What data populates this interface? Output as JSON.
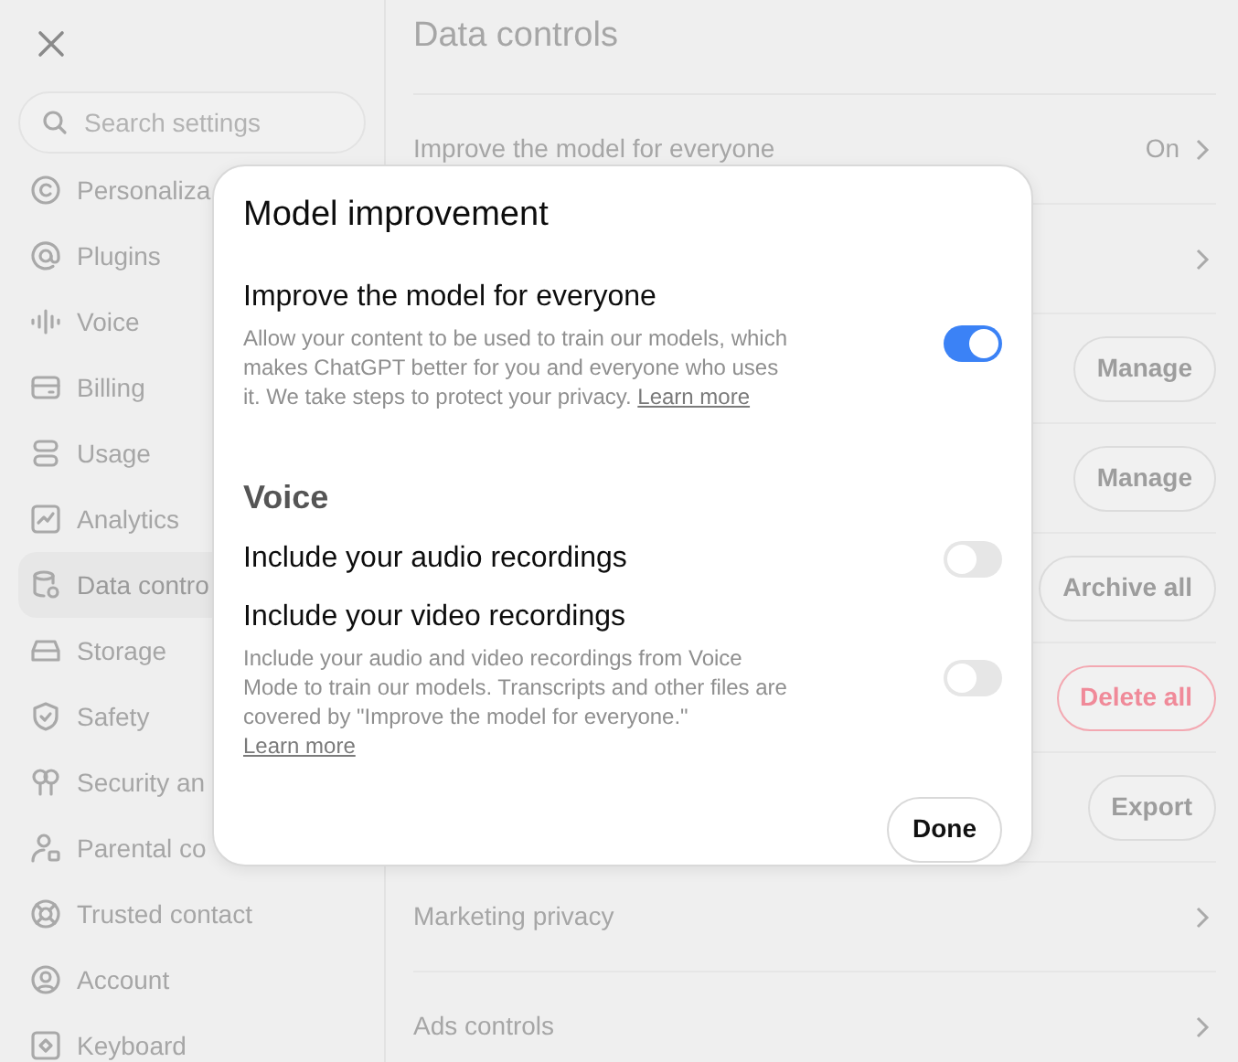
{
  "sidebar": {
    "search": {
      "placeholder": "Search settings"
    },
    "items": [
      {
        "label": "Personaliza",
        "selected": false
      },
      {
        "label": "Plugins",
        "selected": false
      },
      {
        "label": "Voice",
        "selected": false
      },
      {
        "label": "Billing",
        "selected": false
      },
      {
        "label": "Usage",
        "selected": false
      },
      {
        "label": "Analytics",
        "selected": false
      },
      {
        "label": "Data contro",
        "selected": true
      },
      {
        "label": "Storage",
        "selected": false
      },
      {
        "label": "Safety",
        "selected": false
      },
      {
        "label": "Security an",
        "selected": false
      },
      {
        "label": "Parental co",
        "selected": false
      },
      {
        "label": "Trusted contact",
        "selected": false
      },
      {
        "label": "Account",
        "selected": false
      },
      {
        "label": "Keyboard",
        "selected": false
      }
    ]
  },
  "main": {
    "title": "Data controls",
    "rows": [
      {
        "kind": "link",
        "label": "Improve the model for everyone",
        "value": "On"
      },
      {
        "kind": "link"
      },
      {
        "kind": "button",
        "button": "Manage",
        "danger": false
      },
      {
        "kind": "button",
        "button": "Manage",
        "danger": false
      },
      {
        "kind": "button",
        "button": "Archive all",
        "danger": false
      },
      {
        "kind": "button",
        "button": "Delete all",
        "danger": true
      },
      {
        "kind": "button",
        "button": "Export",
        "danger": false
      },
      {
        "kind": "link",
        "label": "Marketing privacy"
      },
      {
        "kind": "link",
        "label": "Ads controls"
      }
    ]
  },
  "dialog": {
    "title": "Model improvement",
    "settings": [
      {
        "label": "Improve the model for everyone",
        "description": "Allow your content to be used to train our models, which makes ChatGPT better for you and everyone who uses it. We take steps to protect your privacy.",
        "link": "Learn more",
        "on": true
      }
    ],
    "section": "Voice",
    "voice_settings": [
      {
        "label": "Include your audio recordings",
        "on": false
      },
      {
        "label": "Include your video recordings",
        "description": "Include your audio and video recordings from Voice Mode to train our models. Transcripts and other files are covered by \"Improve the model for everyone.\"",
        "link": "Learn more",
        "on": false
      }
    ],
    "done": "Done"
  }
}
